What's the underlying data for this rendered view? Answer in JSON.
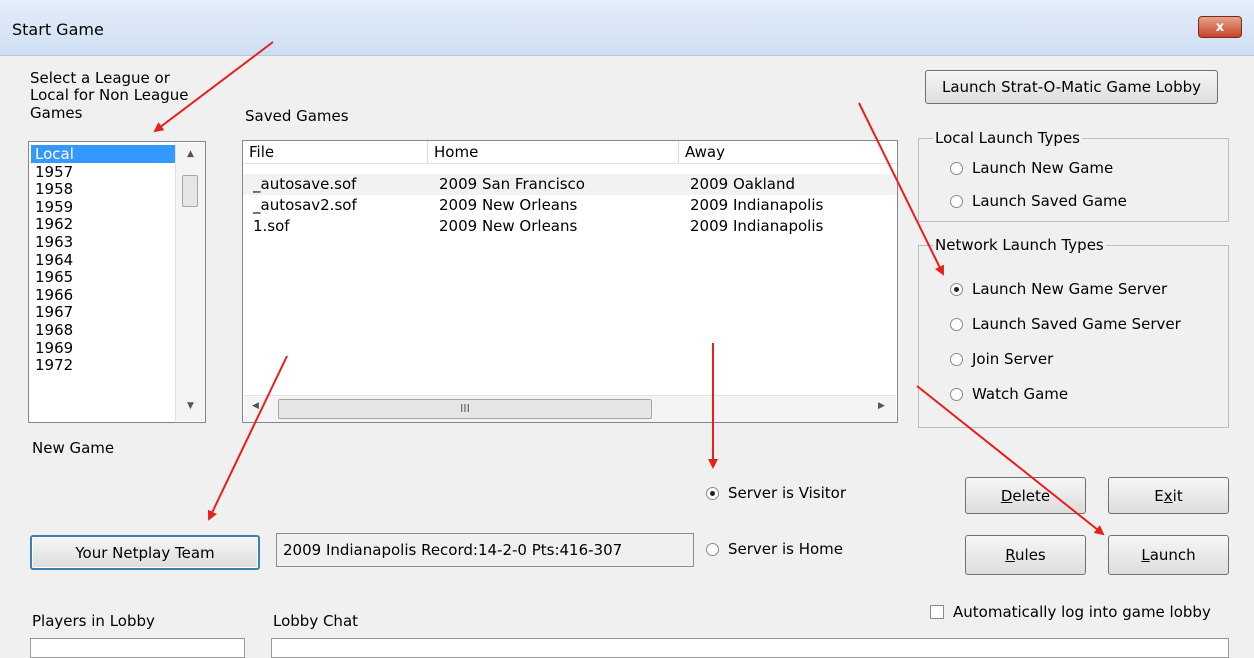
{
  "window": {
    "title": "Start Game",
    "close_glyph": "x"
  },
  "league": {
    "prompt": "Select a League or Local for Non League Games",
    "prompt_lines": [
      "Select a League or",
      "Local for Non League",
      "Games"
    ],
    "items": [
      "Local",
      "1957",
      "1958",
      "1959",
      "1962",
      "1963",
      "1964",
      "1965",
      "1966",
      "1967",
      "1968",
      "1969",
      "1972"
    ],
    "selected": "Local"
  },
  "saved_games": {
    "label": "Saved Games",
    "columns": [
      "File",
      "Home",
      "Away"
    ],
    "rows": [
      {
        "file": "_autosave.sof",
        "home": "2009 San Francisco",
        "away": "2009 Oakland"
      },
      {
        "file": "_autosav2.sof",
        "home": "2009 New Orleans",
        "away": "2009 Indianapolis"
      },
      {
        "file": "1.sof",
        "home": "2009 New Orleans",
        "away": "2009 Indianapolis"
      }
    ],
    "hscroll_thumb_glyph": "III"
  },
  "lobby_button": "Launch Strat-O-Matic Game Lobby",
  "local_launch": {
    "title": "Local Launch Types",
    "options": [
      "Launch New Game",
      "Launch Saved Game"
    ],
    "selected_index": -1
  },
  "network_launch": {
    "title": "Network Launch Types",
    "options": [
      "Launch New Game Server",
      "Launch Saved Game Server",
      "Join Server",
      "Watch Game"
    ],
    "selected_index": 0
  },
  "new_game_label": "New Game",
  "netplay_button": "Your Netplay Team",
  "team_status": "2009 Indianapolis  Record:14-2-0 Pts:416-307",
  "server_side": {
    "options": [
      "Server is Visitor",
      "Server is Home"
    ],
    "selected": "Server is Visitor"
  },
  "buttons": {
    "delete": {
      "label": "Delete",
      "accel": "D"
    },
    "exit": {
      "label": "Exit",
      "accel": "x"
    },
    "rules": {
      "label": "Rules",
      "accel": "R"
    },
    "launch": {
      "label": "Launch",
      "accel": "L"
    }
  },
  "auto_login": {
    "label": "Automatically log into game lobby",
    "checked": false
  },
  "players_in_lobby_label": "Players in Lobby",
  "lobby_chat_label": "Lobby Chat",
  "annotation_color": "#e8201c",
  "icons": {
    "close": "close-icon",
    "scroll_up": "scroll-up-arrow-icon",
    "scroll_down": "scroll-down-arrow-icon",
    "scroll_left": "scroll-left-arrow-icon",
    "scroll_right": "scroll-right-arrow-icon",
    "annotation": "red-arrow-icon"
  }
}
